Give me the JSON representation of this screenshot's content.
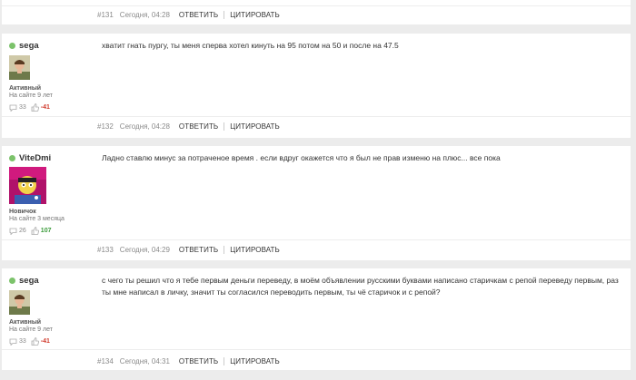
{
  "actions": {
    "reply": "ОТВЕТИТЬ",
    "quote": "ЦИТИРОВАТЬ"
  },
  "top_post": {
    "num": "#131",
    "date": "Сегодня, 04:28"
  },
  "posts": [
    {
      "user": "sega",
      "rank": "Активный",
      "since": "На сайте 9 лет",
      "comments": "33",
      "rep": "-41",
      "text_lines": [
        "хватит гнать пургу, ты меня сперва хотел кинуть на 95 потом на 50 и после на 47.5"
      ],
      "num": "#132",
      "date": "Сегодня, 04:28"
    },
    {
      "user": "ViteDmi",
      "rank": "Новичок",
      "since": "На сайте 3 месяца",
      "comments": "26",
      "rep": "107",
      "text_lines": [
        "Ладно ставлю минус за потраченое время . если вдруг окажется что я был не прав изменю на плюс... все пока"
      ],
      "num": "#133",
      "date": "Сегодня, 04:29"
    },
    {
      "user": "sega",
      "rank": "Активный",
      "since": "На сайте 9 лет",
      "comments": "33",
      "rep": "-41",
      "text_lines": [
        "с чего ты решил что я тебе первым деньги переведу, в моём объявлении русскими буквами написано старичкам с репой переведу первым, раз",
        "ты мне написал в личку, значит ты согласился переводить первым, ты чё старичок и с репой?"
      ],
      "num": "#134",
      "date": "Сегодня, 04:31"
    }
  ],
  "colors": {
    "online": "#7cc36b",
    "rep_negative": "#d03a2c",
    "rep_positive": "#3a9b3a"
  }
}
